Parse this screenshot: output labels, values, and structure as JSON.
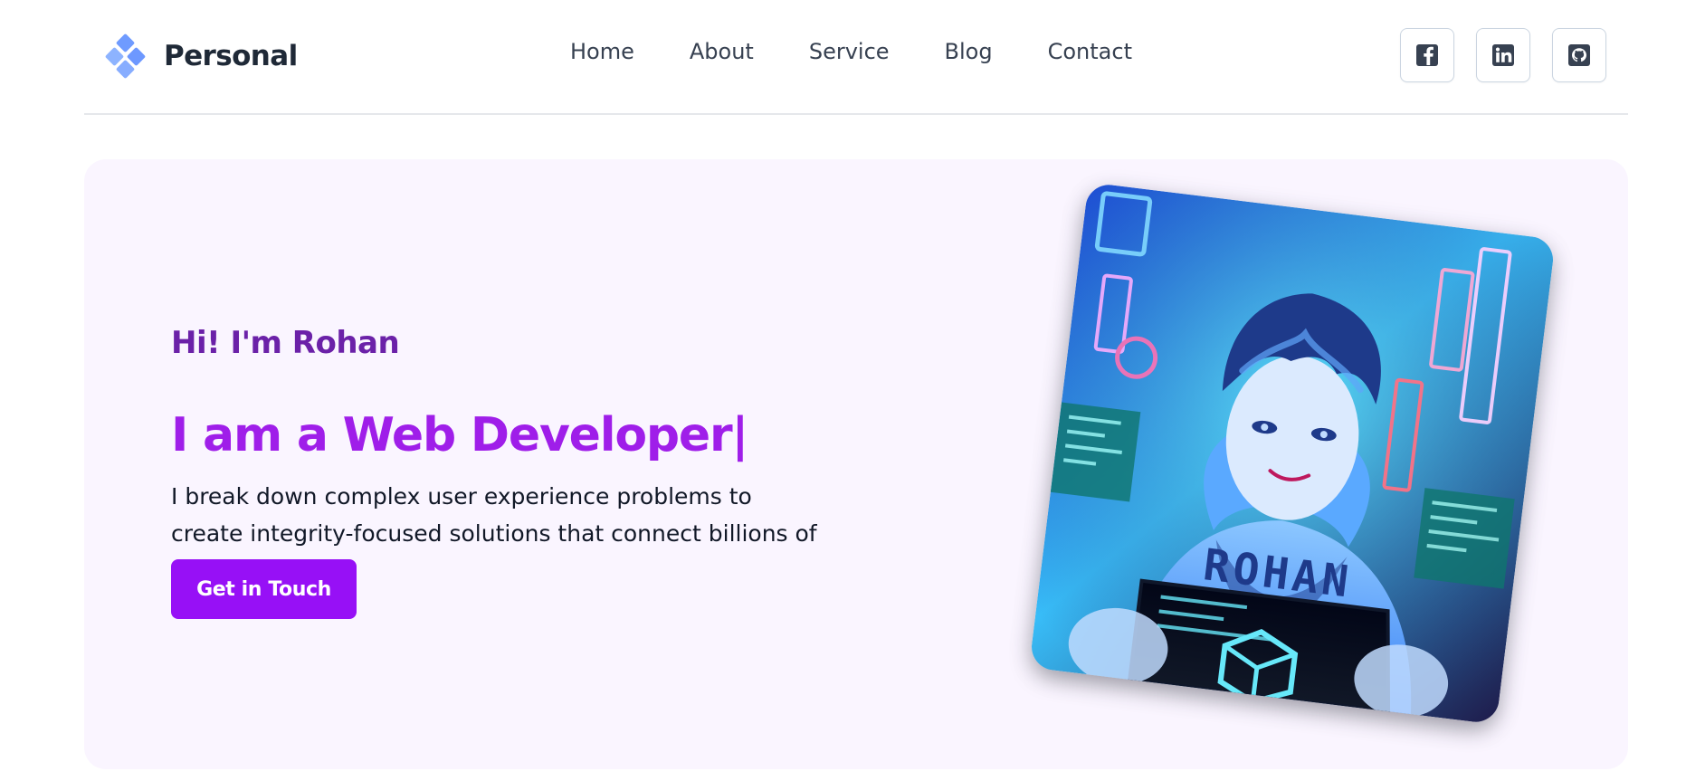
{
  "header": {
    "brand_name": "Personal",
    "brand_icon": "diamond-logo-icon",
    "nav_items": [
      "Home",
      "About",
      "Service",
      "Blog",
      "Contact"
    ],
    "social_icons": [
      "facebook-icon",
      "linkedin-icon",
      "github-icon"
    ]
  },
  "hero": {
    "greeting": "Hi! I'm Rohan",
    "headline": "I am a Web Developer|",
    "description": "I break down complex user experience problems to create integrity-focused solutions that connect billions of people.",
    "cta_label": "Get in Touch",
    "portrait_icon": "developer-avatar-illustration",
    "portrait_text": "ROHAN"
  },
  "colors": {
    "accent": "#9710f6",
    "headline": "#9f1ee9",
    "greeting": "#6b21a8",
    "hero_background": "#faf5ff",
    "brand_icon": "#7aa5ff",
    "text": "#1f2937"
  }
}
